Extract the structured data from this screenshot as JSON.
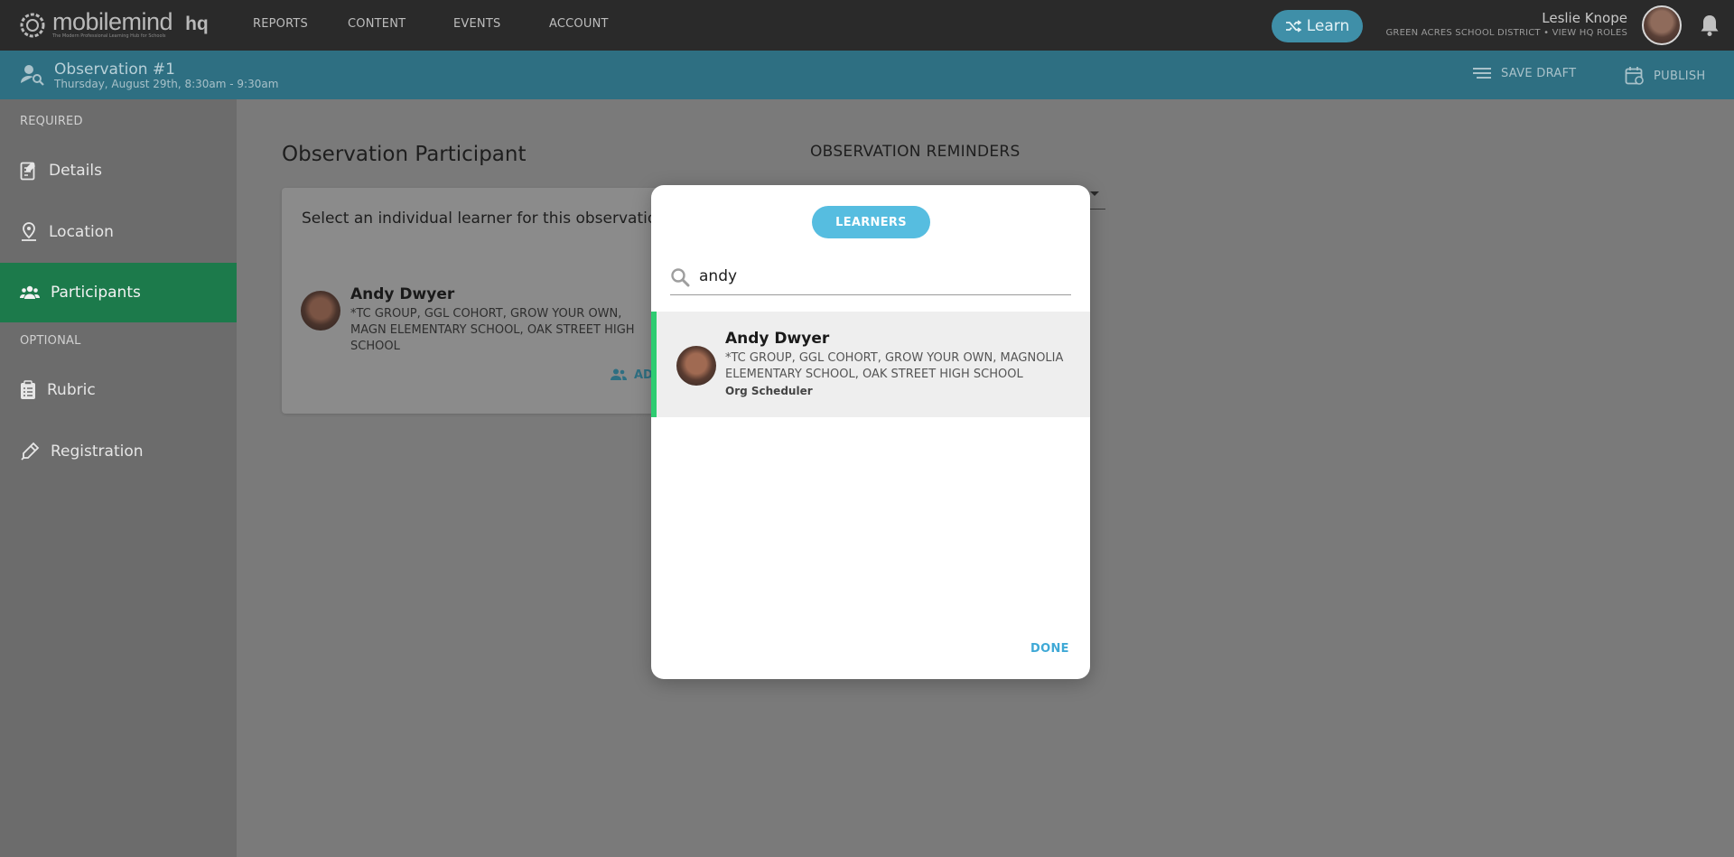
{
  "topbar": {
    "logo_word": "mobilemind",
    "logo_tagline": "The Modern Professional Learning Hub for Schools",
    "logo_hq": "hq",
    "nav": [
      "REPORTS",
      "CONTENT",
      "EVENTS",
      "ACCOUNT"
    ],
    "learn_label": "Learn",
    "user_name": "Leslie Knope",
    "user_sub": "GREEN ACRES SCHOOL DISTRICT • VIEW HQ ROLES"
  },
  "subbar": {
    "title": "Observation #1",
    "date": "Thursday, August 29th, 8:30am - 9:30am",
    "save_draft": "SAVE DRAFT",
    "publish": "PUBLISH"
  },
  "sidebar": {
    "required_label": "REQUIRED",
    "optional_label": "OPTIONAL",
    "items": [
      {
        "label": "Details",
        "icon": "details-icon"
      },
      {
        "label": "Location",
        "icon": "location-pin-icon"
      },
      {
        "label": "Participants",
        "icon": "participants-icon"
      },
      {
        "label": "Rubric",
        "icon": "clipboard-icon"
      },
      {
        "label": "Registration",
        "icon": "pen-icon"
      }
    ]
  },
  "main": {
    "title": "Observation Participant",
    "prompt": "Select an individual learner for this observation.",
    "participant": {
      "name": "Andy Dwyer",
      "groups": "*TC GROUP, GGL COHORT, GROW YOUR OWN, MAGN ELEMENTARY SCHOOL, OAK STREET HIGH SCHOOL"
    },
    "add_label": "AD",
    "reminders_title": "OBSERVATION REMINDERS"
  },
  "modal": {
    "tab_label": "LEARNERS",
    "search_value": "andy",
    "result": {
      "name": "Andy Dwyer",
      "groups": "*TC GROUP, GGL COHORT, GROW YOUR OWN, MAGNOLIA ELEMENTARY SCHOOL, OAK STREET HIGH SCHOOL",
      "role": "Org Scheduler"
    },
    "done_label": "DONE"
  },
  "colors": {
    "topbar": "#2a2a2a",
    "subbar": "#2e6f82",
    "active_sidebar": "#1c7a4b",
    "pill": "#56bde0",
    "selected_bar": "#2ecc71",
    "done": "#3fa9d6"
  }
}
